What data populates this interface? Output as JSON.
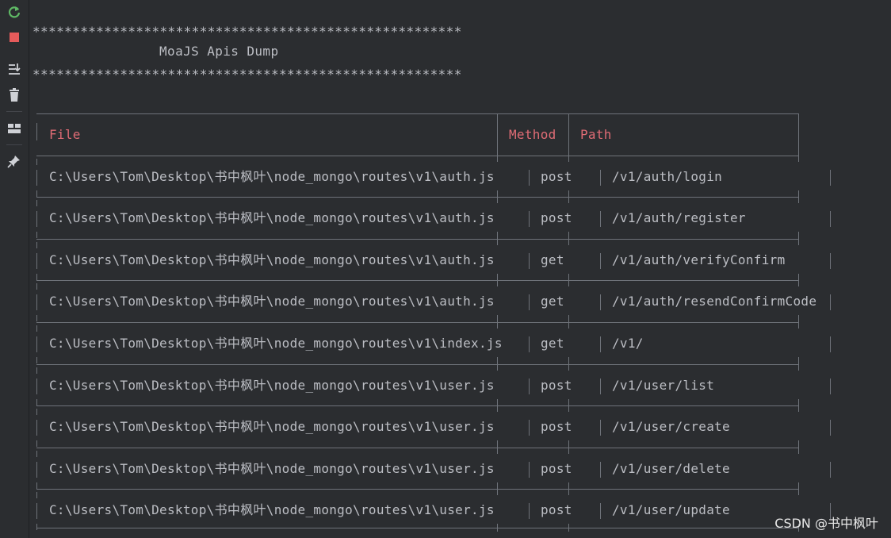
{
  "toolbar": {
    "buttons": [
      {
        "name": "rerun-icon",
        "color": "#5fb865"
      },
      {
        "name": "stop-icon",
        "color": "#e55b5b"
      },
      {
        "name": "scroll-to-end-icon",
        "color": "#cfd1d6"
      },
      {
        "name": "clear-icon",
        "color": "#cfd1d6"
      },
      {
        "name": "layout-icon",
        "color": "#cfd1d6"
      },
      {
        "name": "pin-icon",
        "color": "#cfd1d6"
      }
    ]
  },
  "banner": {
    "stars": "******************************************************",
    "title": "MoaJS Apis Dump"
  },
  "table": {
    "headers": {
      "file": "File",
      "method": "Method",
      "path": "Path"
    },
    "header_color": "#e06c75",
    "rows": [
      {
        "file": "C:\\Users\\Tom\\Desktop\\书中枫叶\\node_mongo\\routes\\v1\\auth.js",
        "method": "post",
        "path": "/v1/auth/login"
      },
      {
        "file": "C:\\Users\\Tom\\Desktop\\书中枫叶\\node_mongo\\routes\\v1\\auth.js",
        "method": "post",
        "path": "/v1/auth/register"
      },
      {
        "file": "C:\\Users\\Tom\\Desktop\\书中枫叶\\node_mongo\\routes\\v1\\auth.js",
        "method": "get",
        "path": "/v1/auth/verifyConfirm"
      },
      {
        "file": "C:\\Users\\Tom\\Desktop\\书中枫叶\\node_mongo\\routes\\v1\\auth.js",
        "method": "get",
        "path": "/v1/auth/resendConfirmCode"
      },
      {
        "file": "C:\\Users\\Tom\\Desktop\\书中枫叶\\node_mongo\\routes\\v1\\index.js",
        "method": "get",
        "path": "/v1/"
      },
      {
        "file": "C:\\Users\\Tom\\Desktop\\书中枫叶\\node_mongo\\routes\\v1\\user.js",
        "method": "post",
        "path": "/v1/user/list"
      },
      {
        "file": "C:\\Users\\Tom\\Desktop\\书中枫叶\\node_mongo\\routes\\v1\\user.js",
        "method": "post",
        "path": "/v1/user/create"
      },
      {
        "file": "C:\\Users\\Tom\\Desktop\\书中枫叶\\node_mongo\\routes\\v1\\user.js",
        "method": "post",
        "path": "/v1/user/delete"
      },
      {
        "file": "C:\\Users\\Tom\\Desktop\\书中枫叶\\node_mongo\\routes\\v1\\user.js",
        "method": "post",
        "path": "/v1/user/update"
      }
    ]
  },
  "watermark": "CSDN @书中枫叶"
}
